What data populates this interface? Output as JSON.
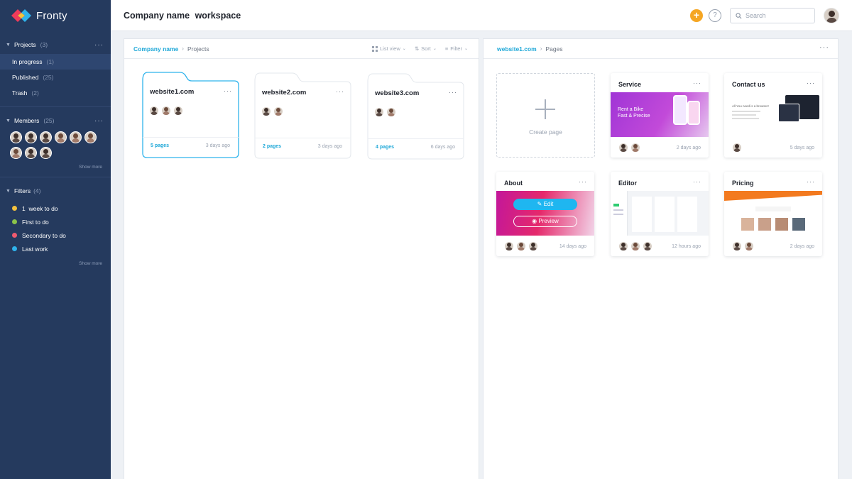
{
  "brand": {
    "name": "Fronty"
  },
  "header": {
    "company": "Company name",
    "workspace": "workspace",
    "search_placeholder": "Search"
  },
  "sidebar": {
    "projects": {
      "label": "Projects",
      "count": "(3)",
      "items": [
        {
          "label": "In progress",
          "count": "(1)"
        },
        {
          "label": "Published",
          "count": "(25)"
        },
        {
          "label": "Trash",
          "count": "(2)"
        }
      ]
    },
    "members": {
      "label": "Members",
      "count": "(25)",
      "show_more": "Show more"
    },
    "filters": {
      "label": "Filters",
      "count": "(4)",
      "items": [
        {
          "label": "1  week to do",
          "color": "#f5c23e"
        },
        {
          "label": "First to do",
          "color": "#8bc34a"
        },
        {
          "label": "Secondary to do",
          "color": "#ef5a6f"
        },
        {
          "label": "Last work",
          "color": "#2fb3ec"
        }
      ],
      "show_more": "Show more"
    }
  },
  "projects_panel": {
    "crumb_root": "Company name",
    "crumb_current": "Projects",
    "tools": {
      "list_view": "List view",
      "sort": "Sort",
      "filter": "Filter"
    },
    "folders": [
      {
        "title": "website1.com",
        "pages": "5 pages",
        "date": "3 days ago"
      },
      {
        "title": "website2.com",
        "pages": "2 pages",
        "date": "3 days ago"
      },
      {
        "title": "website3.com",
        "pages": "4 pages",
        "date": "6 days ago"
      }
    ]
  },
  "pages_panel": {
    "crumb_root": "website1.com",
    "crumb_current": "Pages",
    "create_label": "Create page",
    "cards": [
      {
        "title": "Service",
        "date": "2 days ago",
        "thumb_text": "Rent a Bike\nFast & Precise"
      },
      {
        "title": "Contact us",
        "date": "5 days ago",
        "thumb_text": "All You need is a browser!"
      },
      {
        "title": "About",
        "date": "14 days ago",
        "edit": "Edit",
        "preview": "Preview"
      },
      {
        "title": "Editor",
        "date": "12 hours ago"
      },
      {
        "title": "Pricing",
        "date": "2 days ago"
      }
    ]
  },
  "colors": {
    "sidebar": "#253a5e",
    "accent": "#1fa8d8",
    "plus": "#f5a623"
  }
}
